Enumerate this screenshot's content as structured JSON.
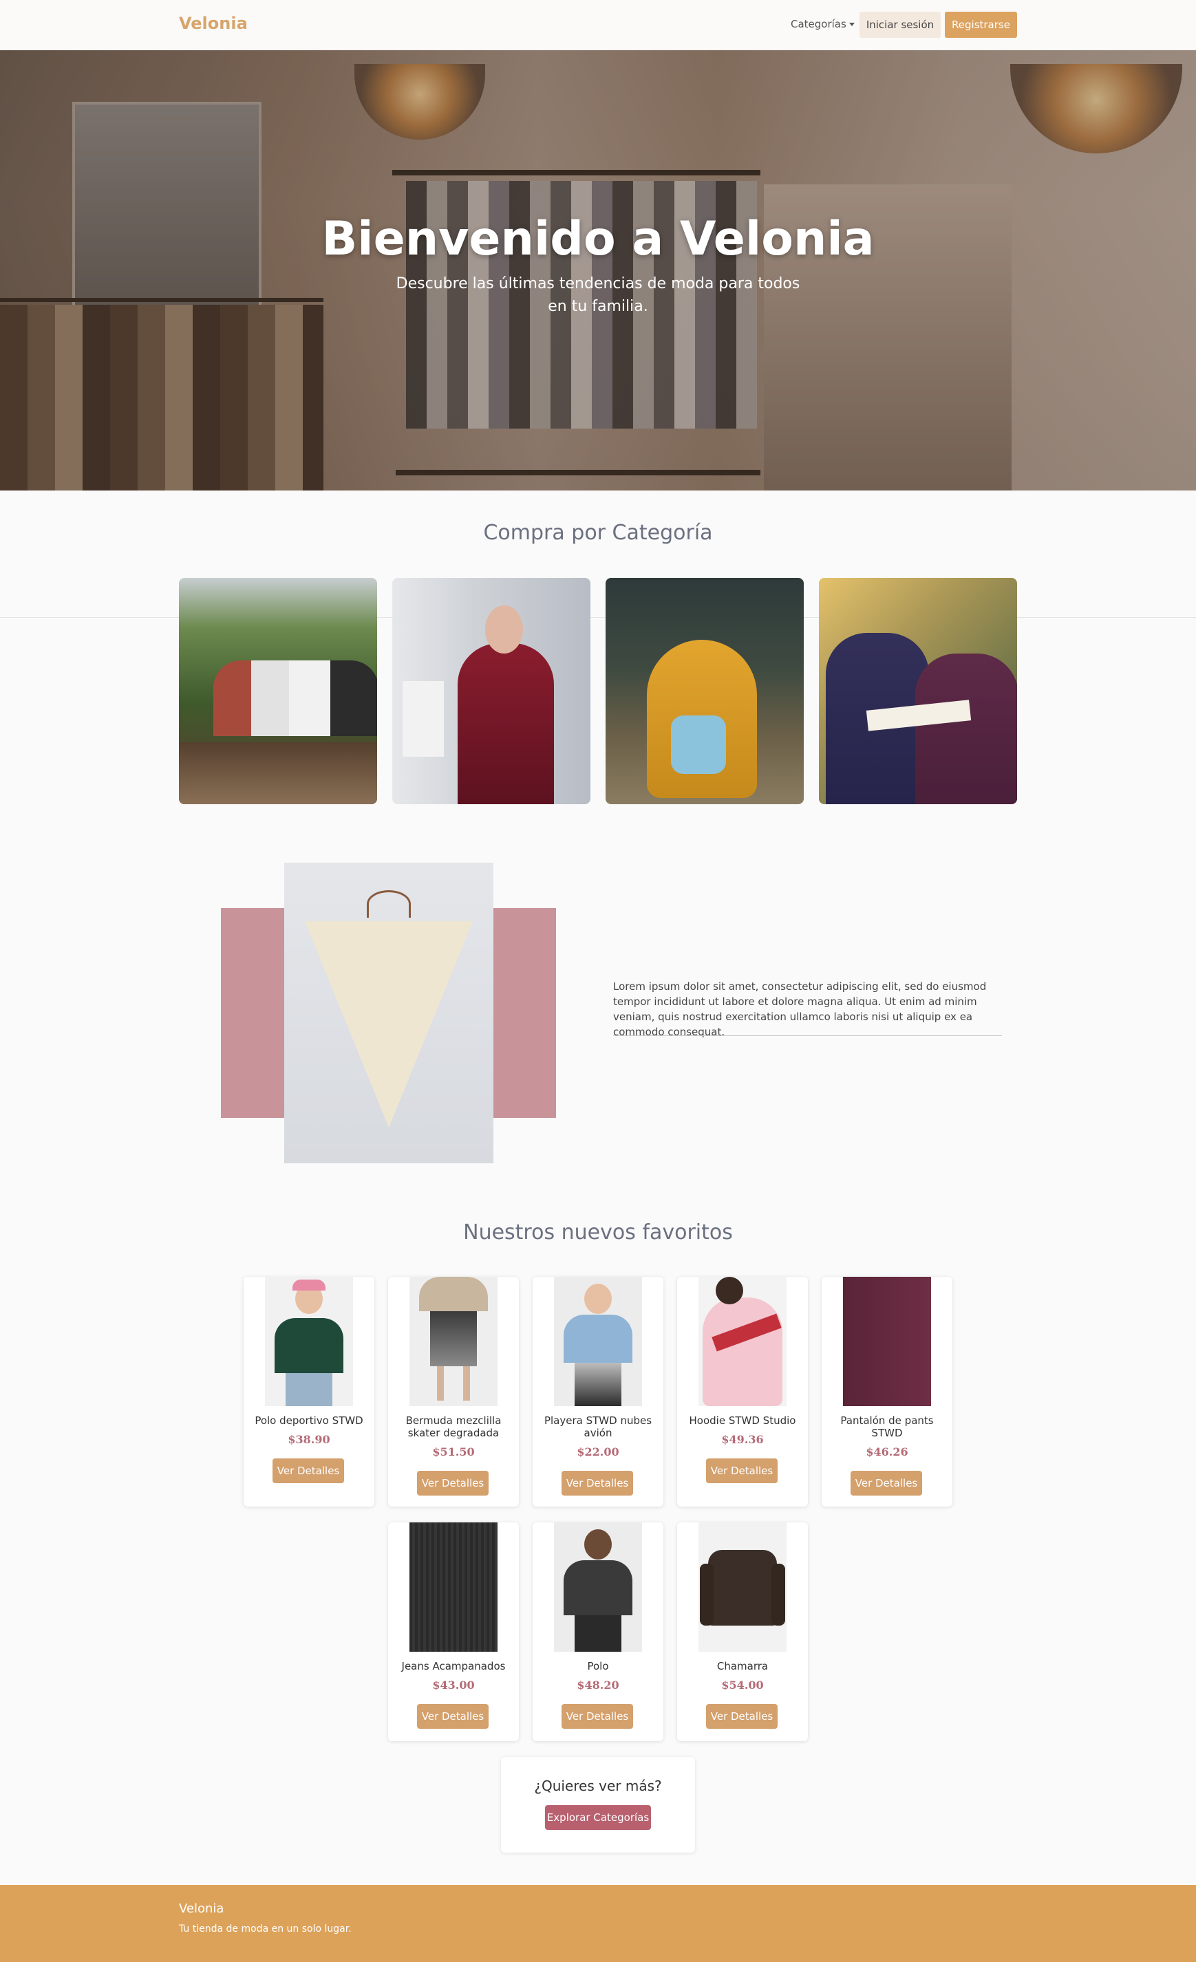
{
  "navbar": {
    "brand": "Velonia",
    "categories_label": "Categorías",
    "login_label": "Iniciar sesión",
    "register_label": "Registrarse"
  },
  "hero": {
    "title": "Bienvenido a Velonia",
    "subtitle": "Descubre las últimas tendencias de moda para todos en tu familia."
  },
  "categories": {
    "title": "Compra por Categoría"
  },
  "feature": {
    "text": "Lorem ipsum dolor sit amet, consectetur adipiscing elit, sed do eiusmod tempor incididunt ut labore et dolore magna aliqua. Ut enim ad minim veniam, quis nostrud exercitation ullamco laboris nisi ut aliquip ex ea commodo consequat."
  },
  "products": {
    "title": "Nuestros nuevos favoritos",
    "button_label": "Ver Detalles",
    "items": [
      {
        "name": "Polo deportivo STWD",
        "price": "$38.90"
      },
      {
        "name": "Bermuda mezclilla skater degradada",
        "price": "$51.50"
      },
      {
        "name": "Playera STWD nubes avión",
        "price": "$22.00"
      },
      {
        "name": "Hoodie STWD Studio",
        "price": "$49.36"
      },
      {
        "name": "Pantalón de pants STWD",
        "price": "$46.26"
      },
      {
        "name": "Jeans Acampanados",
        "price": "$43.00"
      },
      {
        "name": "Polo",
        "price": "$48.20"
      },
      {
        "name": "Chamarra",
        "price": "$54.00"
      }
    ]
  },
  "more": {
    "question": "¿Quieres ver más?",
    "button_label": "Explorar Categorías"
  },
  "footer": {
    "brand": "Velonia",
    "tagline": "Tu tienda de moda en un solo lugar."
  },
  "colors": {
    "brand": "#d7a56b",
    "register": "#dca260",
    "price": "#b56a75",
    "detail_button": "#d4a06c",
    "explore_button": "#b8606e",
    "footer": "#dda25a"
  }
}
